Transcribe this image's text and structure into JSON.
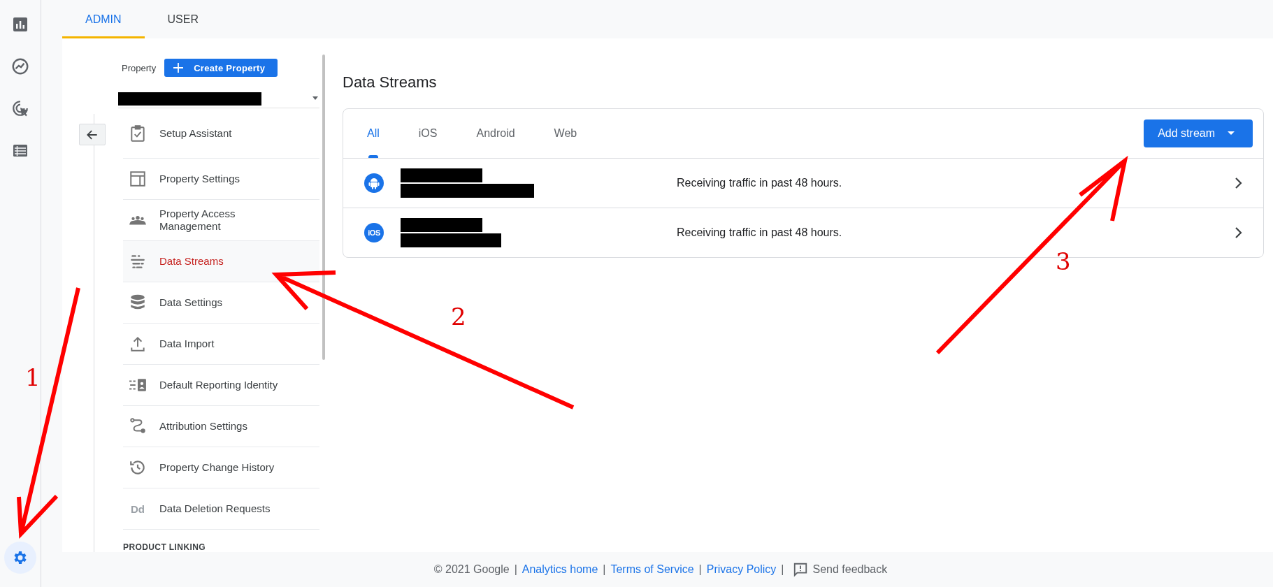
{
  "rail": {
    "items": [
      {
        "selected": false
      },
      {
        "selected": false
      },
      {
        "selected": false
      },
      {
        "selected": false
      }
    ],
    "settings": {
      "selected": true
    }
  },
  "top_tabs": [
    {
      "label": "ADMIN",
      "selected": true
    },
    {
      "label": "USER",
      "selected": false
    }
  ],
  "property": {
    "label": "Property",
    "create_button": "Create Property"
  },
  "menu": [
    {
      "label": "Setup Assistant",
      "selected": false
    },
    {
      "label": "Property Settings",
      "selected": false
    },
    {
      "label": "Property Access Management",
      "selected": false
    },
    {
      "label": "Data Streams",
      "selected": true
    },
    {
      "label": "Data Settings",
      "selected": false
    },
    {
      "label": "Data Import",
      "selected": false
    },
    {
      "label": "Default Reporting Identity",
      "selected": false
    },
    {
      "label": "Attribution Settings",
      "selected": false
    },
    {
      "label": "Property Change History",
      "selected": false
    },
    {
      "label": "Data Deletion Requests",
      "selected": false,
      "icon_text": "Dd"
    }
  ],
  "menu_section": "PRODUCT LINKING",
  "page_title": "Data Streams",
  "stream_tabs": [
    {
      "label": "All",
      "selected": true
    },
    {
      "label": "iOS",
      "selected": false
    },
    {
      "label": "Android",
      "selected": false
    },
    {
      "label": "Web",
      "selected": false
    }
  ],
  "add_button": "Add stream",
  "streams": [
    {
      "kind": "android",
      "status": "Receiving traffic in past 48 hours."
    },
    {
      "kind": "ios",
      "badge": "iOS",
      "status": "Receiving traffic in past 48 hours."
    }
  ],
  "footer": [
    {
      "kind": "text",
      "text": "© 2021 Google"
    },
    {
      "kind": "sep",
      "text": "|"
    },
    {
      "kind": "link",
      "text": "Analytics home"
    },
    {
      "kind": "sep",
      "text": "|"
    },
    {
      "kind": "link",
      "text": "Terms of Service"
    },
    {
      "kind": "sep",
      "text": "|"
    },
    {
      "kind": "link",
      "text": "Privacy Policy"
    },
    {
      "kind": "sep",
      "text": "|"
    },
    {
      "kind": "feedback",
      "text": "Send feedback"
    }
  ],
  "annotations": [
    {
      "label": "1"
    },
    {
      "label": "2"
    },
    {
      "label": "3"
    }
  ]
}
